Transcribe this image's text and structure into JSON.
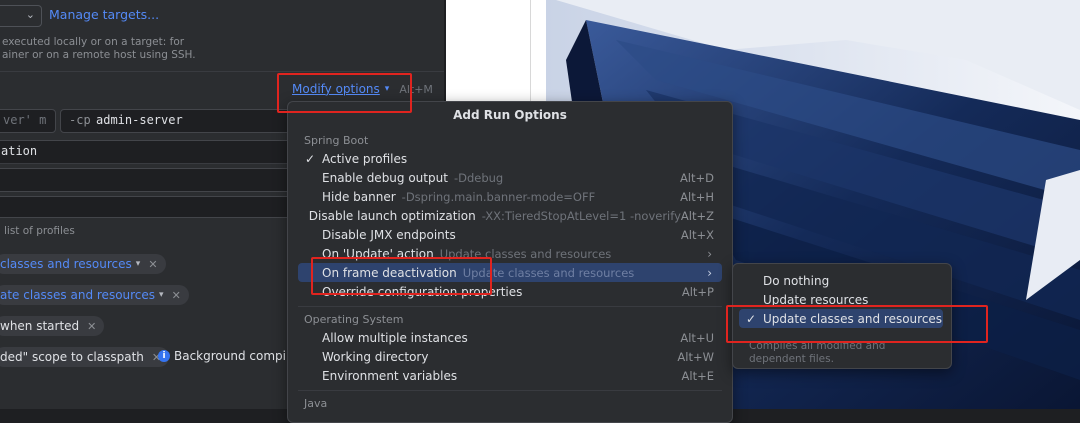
{
  "left": {
    "manage_targets": "Manage targets...",
    "target_desc_line1": "executed locally or on a target: for",
    "target_desc_line2": "ainer or on a remote host using SSH.",
    "modify_options": "Modify options",
    "modify_shortcut": "Alt+M",
    "vm_field": "ver' m",
    "cp_flag": "-cp",
    "cp_value": "admin-server",
    "main_class_fragment": "ation",
    "profiles_hint": "list of profiles",
    "chips": [
      {
        "label": "classes and resources"
      },
      {
        "label": "ate classes and resources"
      },
      {
        "label": "when started"
      },
      {
        "label": "ded\" scope to classpath"
      }
    ],
    "background_text": "Background compilat"
  },
  "popup": {
    "title": "Add Run Options",
    "groups": [
      "Spring Boot",
      "Operating System",
      "Java"
    ],
    "spring_items": [
      {
        "check": "✓",
        "label": "Active profiles",
        "hint": "",
        "shortcut": ""
      },
      {
        "check": "",
        "label": "Enable debug output",
        "hint": "-Ddebug",
        "shortcut": "Alt+D"
      },
      {
        "check": "",
        "label": "Hide banner",
        "hint": "-Dspring.main.banner-mode=OFF",
        "shortcut": "Alt+H"
      },
      {
        "check": "",
        "label": "Disable launch optimization",
        "hint": "-XX:TieredStopAtLevel=1 -noverify",
        "shortcut": "Alt+Z"
      },
      {
        "check": "",
        "label": "Disable JMX endpoints",
        "hint": "",
        "shortcut": "Alt+X"
      },
      {
        "check": "",
        "label": "On 'Update' action",
        "hint": "Update classes and resources",
        "shortcut": "›"
      },
      {
        "check": "",
        "label": "On frame deactivation",
        "hint": "Update classes and resources",
        "shortcut": "›"
      },
      {
        "check": "",
        "label": "Override configuration properties",
        "hint": "",
        "shortcut": "Alt+P"
      }
    ],
    "os_items": [
      {
        "label": "Allow multiple instances",
        "shortcut": "Alt+U"
      },
      {
        "label": "Working directory",
        "shortcut": "Alt+W"
      },
      {
        "label": "Environment variables",
        "shortcut": "Alt+E"
      }
    ]
  },
  "submenu": {
    "items": [
      {
        "check": "",
        "label": "Do nothing"
      },
      {
        "check": "",
        "label": "Update resources"
      },
      {
        "check": "✓",
        "label": "Update classes and resources"
      }
    ],
    "hint": "Compiles all modified and dependent files."
  },
  "colors": {
    "accent": "#548af7",
    "selection": "#2e436e",
    "highlight_box": "#e0241f"
  }
}
